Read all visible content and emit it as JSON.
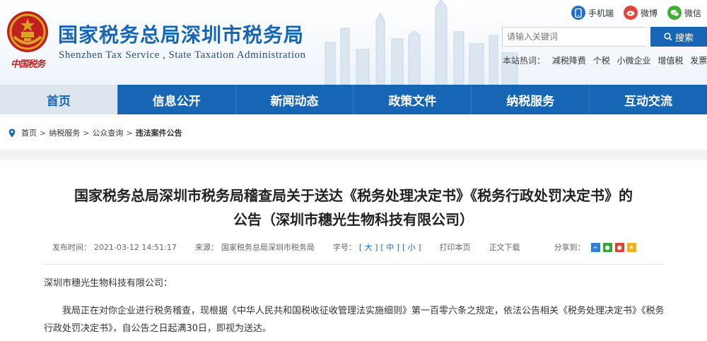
{
  "header": {
    "title": "国家税务总局深圳市税务局",
    "subtitle": "Shenzhen Tax Service , State Taxation Administration",
    "brand_mark": "中国税务",
    "social": [
      {
        "icon": "mobile-icon",
        "label": "手机端"
      },
      {
        "icon": "weibo-icon",
        "label": "微博"
      },
      {
        "icon": "wechat-icon",
        "label": "微信"
      }
    ],
    "search": {
      "placeholder": "请输入关键词",
      "button_label": "搜索"
    },
    "hotwords": {
      "label": "本站热词：",
      "items": [
        "减税降费",
        "个税",
        "小微企业",
        "增值税",
        "发票"
      ]
    }
  },
  "nav": {
    "items": [
      {
        "label": "首页",
        "active": true
      },
      {
        "label": "信息公开"
      },
      {
        "label": "新闻动态"
      },
      {
        "label": "政策文件"
      },
      {
        "label": "纳税服务"
      },
      {
        "label": "互动交流"
      }
    ]
  },
  "breadcrumb": {
    "items": [
      "首页",
      "纳税服务",
      "公众查询",
      "违法案件公告"
    ],
    "separator": ">"
  },
  "article": {
    "title_line1": "国家税务总局深圳市税务局稽查局关于送达《税务处理决定书》《税务行政处罚决定书》的",
    "title_line2": "公告（深圳市穗光生物科技有限公司）",
    "meta": {
      "date_label": "发布时间：",
      "date": "2021-03-12 14:51:17",
      "source_label": "来源：",
      "source": "国家税务总局深圳市税务局",
      "font_label": "字号：",
      "font_large": "[ 大 ]",
      "font_medium": "[ 中 ]",
      "font_small": "[ 小 ]",
      "print_label": "打印本页",
      "download_label": "正文下载",
      "share_label": "分享到："
    },
    "addressee": "深圳市穗光生物科技有限公司：",
    "body": "我局正在对你企业进行税务稽查，现根据《中华人民共和国税收征收管理法实施细则》第一百零六条之规定，依法公告相关《税务处理决定书》《税务行政处罚决定书》，自公告之日起满30日，即视为送达。"
  },
  "colors": {
    "brand_blue": "#1766b5",
    "nav_active_bg": "#dde6ef",
    "emblem_red": "#c21f1f",
    "gold": "#d9a520"
  }
}
